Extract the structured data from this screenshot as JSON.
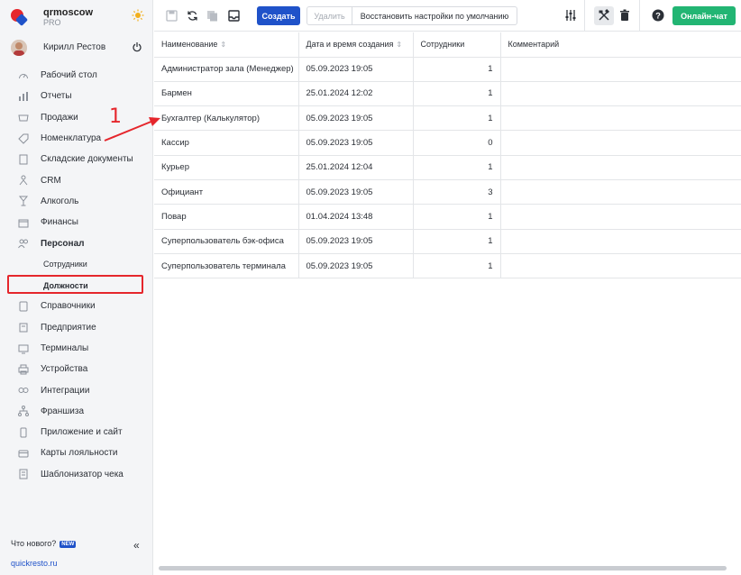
{
  "brand": {
    "name": "qrmoscow",
    "plan": "PRO"
  },
  "user": {
    "name": "Кирилл Рестов"
  },
  "nav": {
    "items": [
      {
        "label": "Рабочий стол",
        "icon": "gauge-icon"
      },
      {
        "label": "Отчеты",
        "icon": "chart-icon"
      },
      {
        "label": "Продажи",
        "icon": "basket-icon"
      },
      {
        "label": "Номенклатура",
        "icon": "tag-icon"
      },
      {
        "label": "Складские документы",
        "icon": "document-icon"
      },
      {
        "label": "CRM",
        "icon": "crm-icon"
      },
      {
        "label": "Алкоголь",
        "icon": "glass-icon"
      },
      {
        "label": "Финансы",
        "icon": "wallet-icon"
      },
      {
        "label": "Персонал",
        "icon": "people-icon"
      }
    ],
    "sub": [
      {
        "label": "Сотрудники"
      },
      {
        "label": "Должности"
      }
    ],
    "items2": [
      {
        "label": "Справочники",
        "icon": "book-icon"
      },
      {
        "label": "Предприятие",
        "icon": "building-icon"
      },
      {
        "label": "Терминалы",
        "icon": "terminal-icon"
      },
      {
        "label": "Устройства",
        "icon": "printer-icon"
      },
      {
        "label": "Интеграции",
        "icon": "link-icon"
      },
      {
        "label": "Франшиза",
        "icon": "network-icon"
      },
      {
        "label": "Приложение и сайт",
        "icon": "phone-icon"
      },
      {
        "label": "Карты лояльности",
        "icon": "card-icon"
      },
      {
        "label": "Шаблонизатор чека",
        "icon": "receipt-icon"
      }
    ]
  },
  "footer": {
    "whats_new": "Что нового?",
    "badge": "NEW",
    "site": "quickresto.ru"
  },
  "toolbar": {
    "create": "Создать",
    "delete": "Удалить",
    "restore": "Восстановить настройки по умолчанию",
    "chat": "Онлайн-чат"
  },
  "table": {
    "headers": [
      "Наименование",
      "Дата и время создания",
      "Сотрудники",
      "Комментарий"
    ],
    "rows": [
      [
        "Администратор зала (Менеджер)",
        "05.09.2023 19:05",
        "1",
        ""
      ],
      [
        "Бармен",
        "25.01.2024 12:02",
        "1",
        ""
      ],
      [
        "Бухгалтер (Калькулятор)",
        "05.09.2023 19:05",
        "1",
        ""
      ],
      [
        "Кассир",
        "05.09.2023 19:05",
        "0",
        ""
      ],
      [
        "Курьер",
        "25.01.2024 12:04",
        "1",
        ""
      ],
      [
        "Официант",
        "05.09.2023 19:05",
        "3",
        ""
      ],
      [
        "Повар",
        "01.04.2024 13:48",
        "1",
        ""
      ],
      [
        "Суперпользователь бэк-офиса",
        "05.09.2023 19:05",
        "1",
        ""
      ],
      [
        "Суперпользователь терминала",
        "05.09.2023 19:05",
        "1",
        ""
      ]
    ]
  },
  "annotation": {
    "number": "1"
  },
  "colors": {
    "accent": "#1f52c9",
    "chat": "#22b573",
    "highlight": "#e5262c"
  }
}
